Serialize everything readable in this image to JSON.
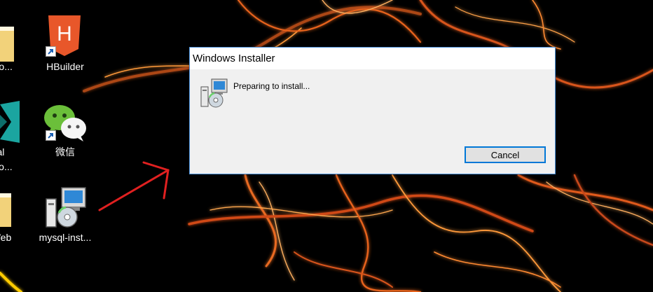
{
  "desktop": {
    "icons": [
      {
        "label": "e-to...",
        "icon": "folder-icon"
      },
      {
        "label": "HBuilder",
        "icon": "hbuilder-icon"
      },
      {
        "label_line1": "ual",
        "label_line2": "o Co...",
        "icon": "vscode-icon"
      },
      {
        "label": "微信",
        "icon": "wechat-icon"
      },
      {
        "label": "Web",
        "icon": "folder-icon"
      },
      {
        "label": "mysql-inst...",
        "icon": "installer-icon"
      }
    ]
  },
  "annotation": {
    "color": "#e02020",
    "icon": "red-arrow"
  },
  "dialog": {
    "title": "Windows Installer",
    "message": "Preparing to install...",
    "cancel_label": "Cancel",
    "accent": "#0078d7"
  }
}
